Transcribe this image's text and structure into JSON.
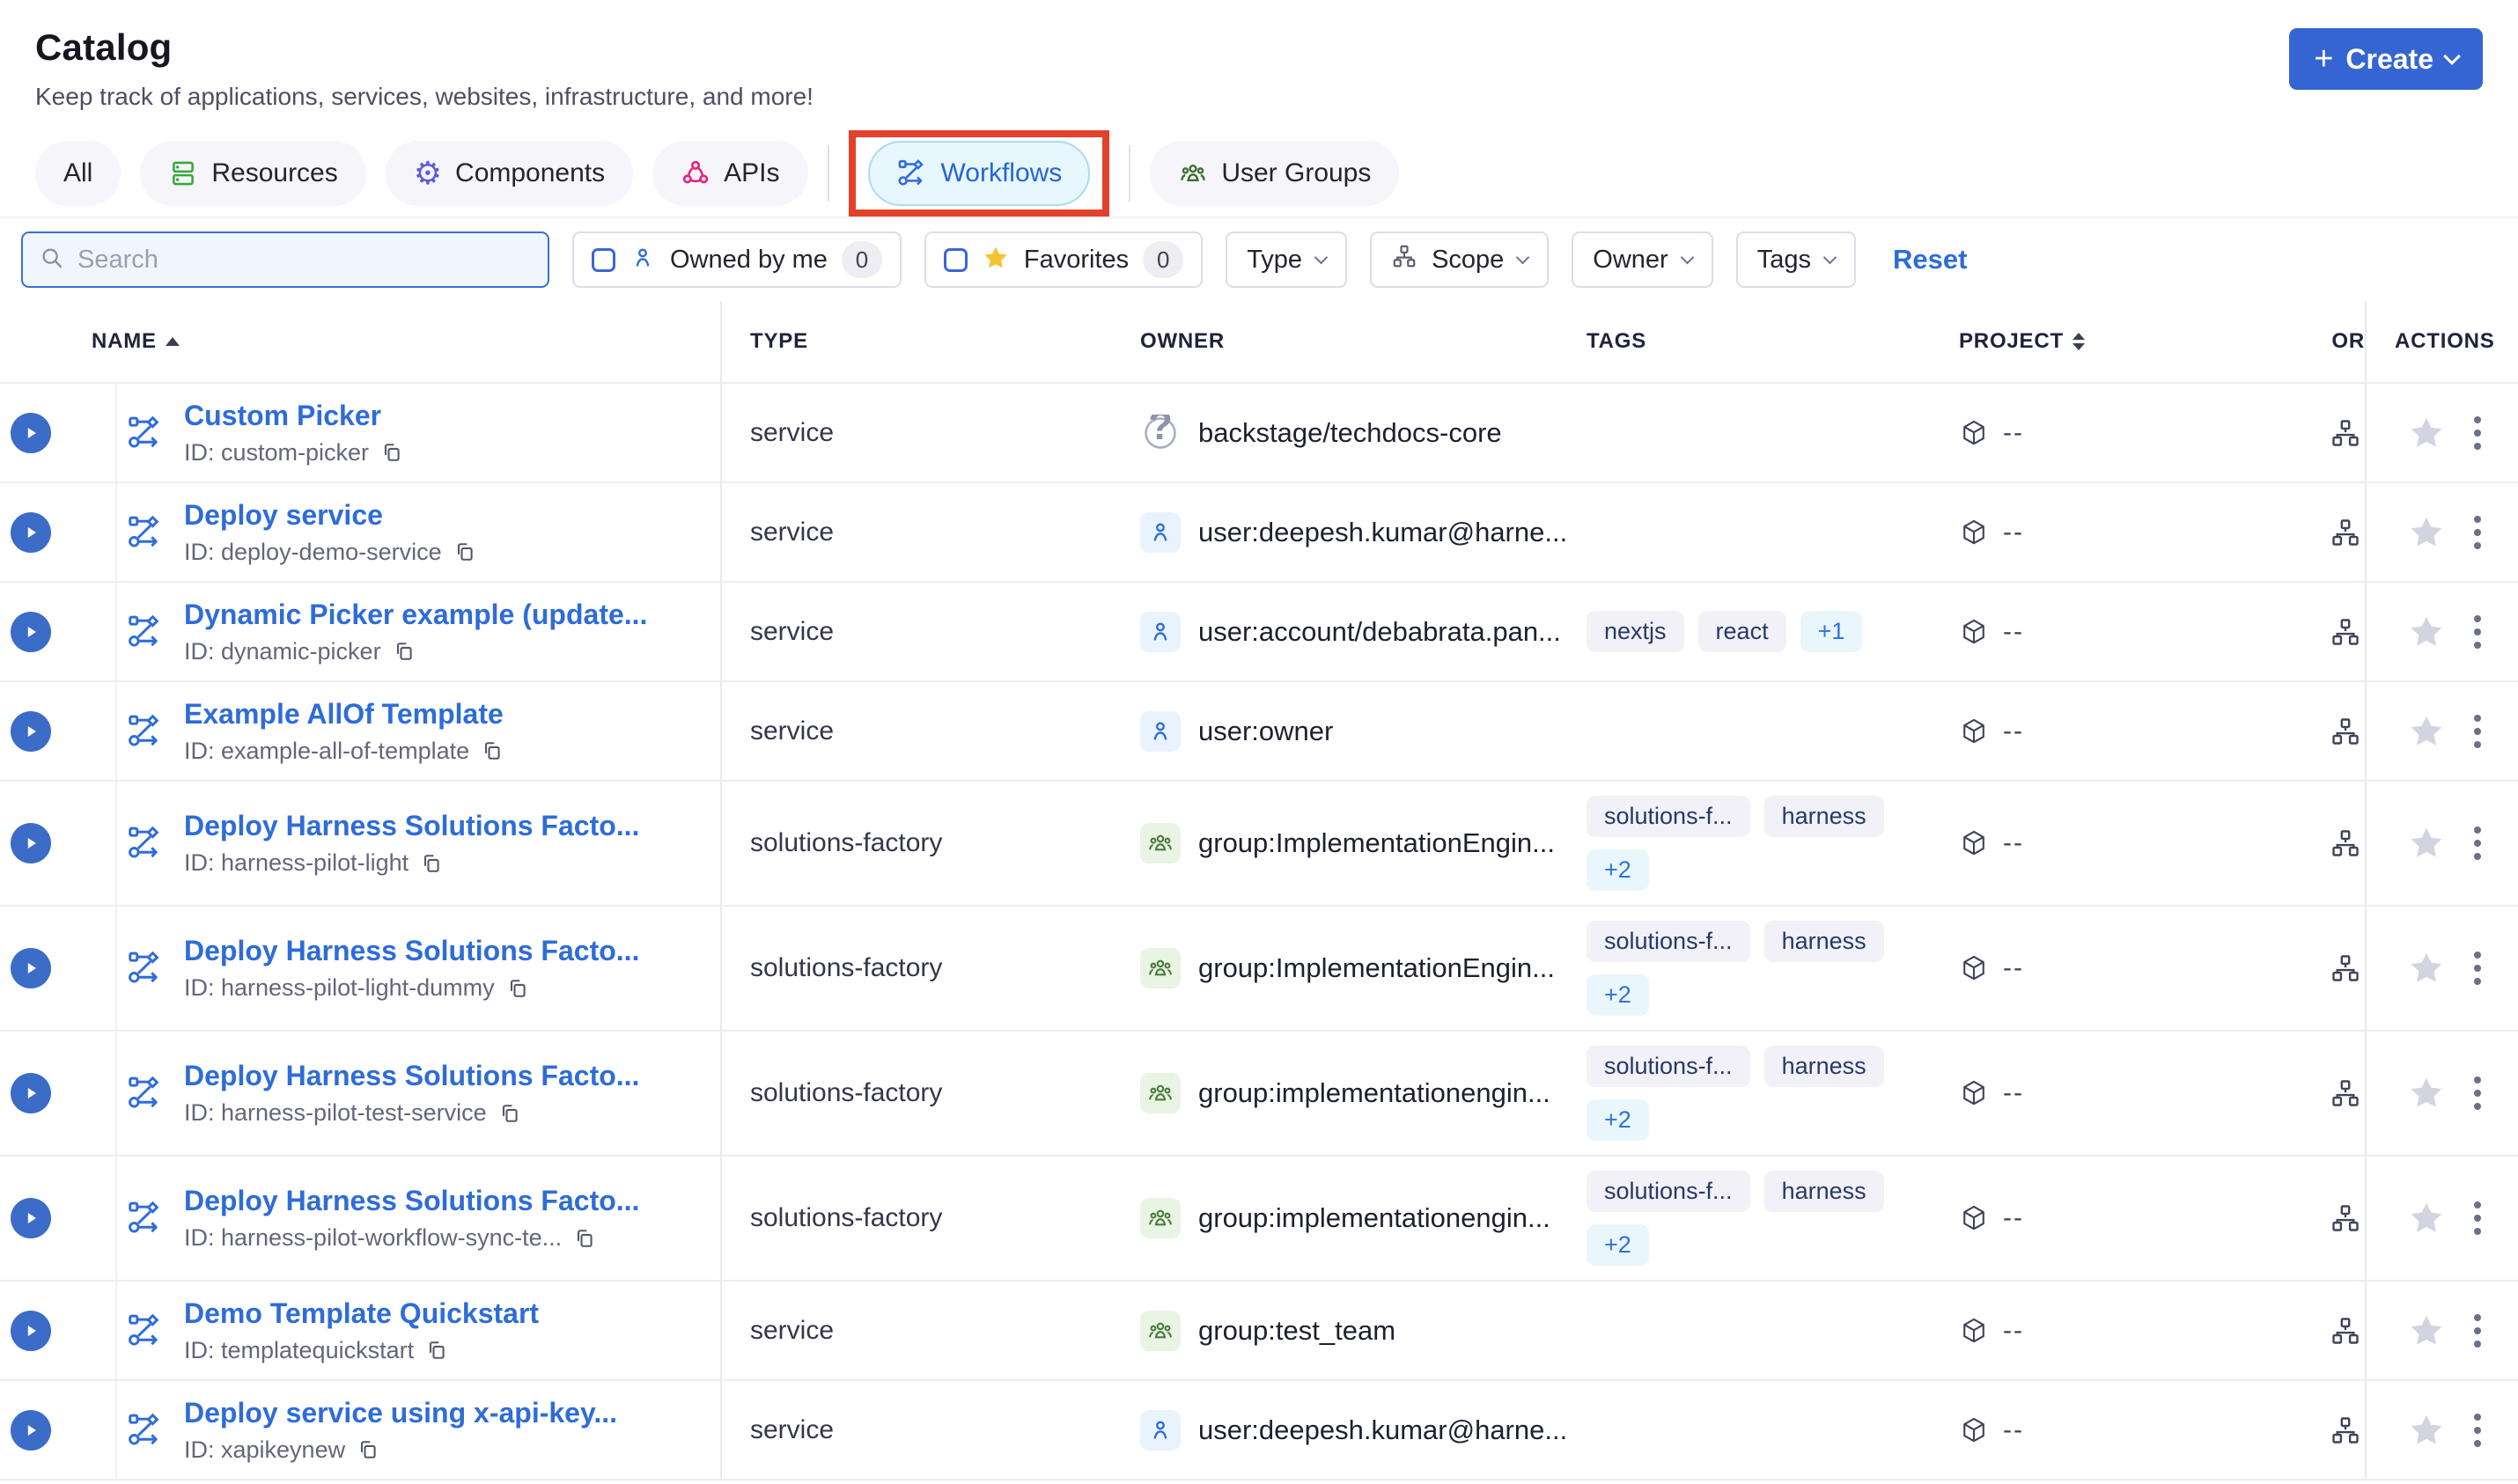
{
  "page": {
    "title": "Catalog",
    "subtitle": "Keep track of applications, services, websites, infrastructure, and more!"
  },
  "create_button": {
    "label": "Create"
  },
  "accent_colors": {
    "primary_blue": "#3565d2",
    "link_blue": "#2e6cd9",
    "selected_tab_bg": "#e8f6fd",
    "annotation_red": "#e2422c",
    "favorites_star": "#f4c430",
    "tag_chip_bg": "#f1f1f7",
    "more_chip_bg": "#e9f6fc"
  },
  "tabs": {
    "items": [
      {
        "label": "All",
        "icon": "none"
      },
      {
        "label": "Resources",
        "icon": "resources-icon"
      },
      {
        "label": "Components",
        "icon": "gear-icon"
      },
      {
        "label": "APIs",
        "icon": "api-icon"
      },
      {
        "label": "Workflows",
        "icon": "workflow-icon",
        "selected": true,
        "annotated": true
      },
      {
        "label": "User Groups",
        "icon": "user-groups-icon"
      }
    ]
  },
  "filters": {
    "search_placeholder": "Search",
    "owned_by_me": {
      "label": "Owned by me",
      "count": "0"
    },
    "favorites": {
      "label": "Favorites",
      "count": "0"
    },
    "dropdowns": [
      {
        "label": "Type"
      },
      {
        "label": "Scope",
        "icon": "hierarchy-icon"
      },
      {
        "label": "Owner"
      },
      {
        "label": "Tags"
      }
    ],
    "reset_label": "Reset"
  },
  "table": {
    "columns": {
      "name": "NAME",
      "type": "TYPE",
      "owner": "OWNER",
      "tags": "TAGS",
      "project": "PROJECT",
      "org": "OR",
      "actions": "ACTIONS"
    },
    "rows": [
      {
        "name": "Custom Picker",
        "id_label": "ID: custom-picker",
        "type": "service",
        "owner": {
          "kind": "unknown",
          "label": "backstage/techdocs-core"
        },
        "tags": [],
        "more": "",
        "tall": false,
        "project": "--"
      },
      {
        "name": "Deploy service",
        "id_label": "ID: deploy-demo-service",
        "type": "service",
        "owner": {
          "kind": "user",
          "label": "user:deepesh.kumar@harne..."
        },
        "tags": [],
        "more": "",
        "tall": false,
        "project": "--"
      },
      {
        "name": "Dynamic Picker example (update...",
        "id_label": "ID: dynamic-picker",
        "type": "service",
        "owner": {
          "kind": "user",
          "label": "user:account/debabrata.pan..."
        },
        "tags": [
          "nextjs",
          "react"
        ],
        "more": "+1",
        "tall": false,
        "project": "--"
      },
      {
        "name": "Example AllOf Template",
        "id_label": "ID: example-all-of-template",
        "type": "service",
        "owner": {
          "kind": "user",
          "label": "user:owner"
        },
        "tags": [],
        "more": "",
        "tall": false,
        "project": "--"
      },
      {
        "name": "Deploy Harness Solutions Facto...",
        "id_label": "ID: harness-pilot-light",
        "type": "solutions-factory",
        "owner": {
          "kind": "group",
          "label": "group:ImplementationEngin..."
        },
        "tags": [
          "solutions-f...",
          "harness"
        ],
        "more": "+2",
        "tall": true,
        "project": "--"
      },
      {
        "name": "Deploy Harness Solutions Facto...",
        "id_label": "ID: harness-pilot-light-dummy",
        "type": "solutions-factory",
        "owner": {
          "kind": "group",
          "label": "group:ImplementationEngin..."
        },
        "tags": [
          "solutions-f...",
          "harness"
        ],
        "more": "+2",
        "tall": true,
        "project": "--"
      },
      {
        "name": "Deploy Harness Solutions Facto...",
        "id_label": "ID: harness-pilot-test-service",
        "type": "solutions-factory",
        "owner": {
          "kind": "group",
          "label": "group:implementationengin..."
        },
        "tags": [
          "solutions-f...",
          "harness"
        ],
        "more": "+2",
        "tall": true,
        "project": "--"
      },
      {
        "name": "Deploy Harness Solutions Facto...",
        "id_label": "ID: harness-pilot-workflow-sync-te...",
        "type": "solutions-factory",
        "owner": {
          "kind": "group",
          "label": "group:implementationengin..."
        },
        "tags": [
          "solutions-f...",
          "harness"
        ],
        "more": "+2",
        "tall": true,
        "project": "--"
      },
      {
        "name": "Demo Template Quickstart",
        "id_label": "ID: templatequickstart",
        "type": "service",
        "owner": {
          "kind": "group",
          "label": "group:test_team"
        },
        "tags": [],
        "more": "",
        "tall": false,
        "project": "--"
      },
      {
        "name": "Deploy service using x-api-key...",
        "id_label": "ID: xapikeynew",
        "type": "service",
        "owner": {
          "kind": "user",
          "label": "user:deepesh.kumar@harne..."
        },
        "tags": [],
        "more": "",
        "tall": false,
        "project": "--"
      }
    ]
  }
}
